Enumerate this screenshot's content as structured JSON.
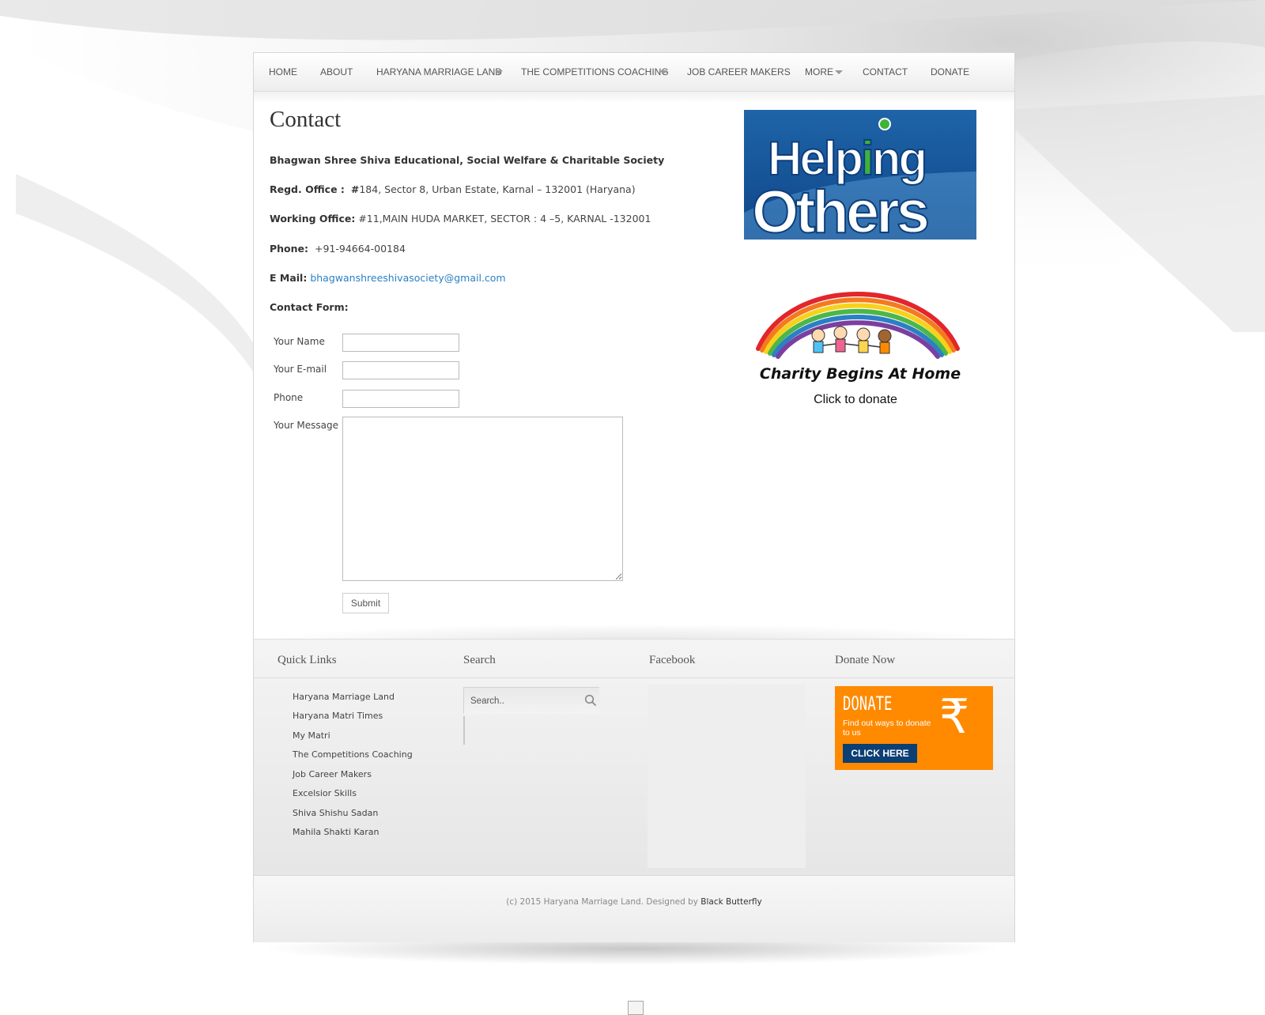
{
  "nav": {
    "items": [
      {
        "label": "HOME"
      },
      {
        "label": "ABOUT"
      },
      {
        "label": "HARYANA MARRIAGE LAND"
      },
      {
        "label": "THE COMPETITIONS COACHING"
      },
      {
        "label": "JOB CAREER MAKERS"
      },
      {
        "label": "MORE"
      },
      {
        "label": "CONTACT"
      },
      {
        "label": "DONATE"
      }
    ]
  },
  "main": {
    "title": "Contact",
    "org_name": "Bhagwan Shree Shiva Educational, Social Welfare & Charitable Society",
    "regd_label": "Regd. Office :",
    "regd_hash": "#",
    "regd_value": "184, Sector 8, Urban Estate, Karnal – 132001 (Haryana)",
    "working_label": "Working Office:",
    "working_value": "#11,MAIN HUDA MARKET, SECTOR : 4 –5, KARNAL -132001",
    "phone_label": "Phone:",
    "phone_value": "+91-94664-00184",
    "email_label": "E Mail:",
    "email_value": "bhagwanshreeshivasociety@gmail.com",
    "form_heading": "Contact Form:",
    "form": {
      "name_label": "Your Name",
      "email_label": "Your E-mail",
      "phone_label": "Phone",
      "message_label": "Your Message",
      "name_value": "",
      "email_value": "",
      "phone_value": "",
      "message_value": "",
      "submit_label": "Submit"
    }
  },
  "sidebar": {
    "helping_top": "Help",
    "helping_i": "i",
    "helping_ng": "ng",
    "helping_bottom": "Others",
    "charity_text": "Charity Begins At Home",
    "charity_cta": "Click to donate"
  },
  "footer": {
    "quick_links_title": "Quick Links",
    "quick_links": [
      "Haryana Marriage Land",
      "Haryana Matri Times",
      "My Matri",
      "The Competitions Coaching",
      "Job Career Makers",
      "Excelsior Skills",
      "Shiva Shishu Sadan",
      "Mahila Shakti Karan"
    ],
    "search_title": "Search",
    "search_placeholder": "Search..",
    "facebook_title": "Facebook",
    "donate_title": "Donate Now",
    "donate_banner": {
      "word": "DONATE",
      "sub": "Find out ways to donate to us",
      "button": "CLICK HERE",
      "symbol": "₹"
    },
    "copyright_prefix": "(c) 2015 Haryana Marriage Land. Designed by",
    "designer": "Black Butterfly"
  },
  "colors": {
    "link": "#2a80c6",
    "donate_orange": "#ff8a00",
    "donate_button": "#0c3f73",
    "helping_blue": "#1a5ba0",
    "helping_green": "#3fb23a"
  }
}
